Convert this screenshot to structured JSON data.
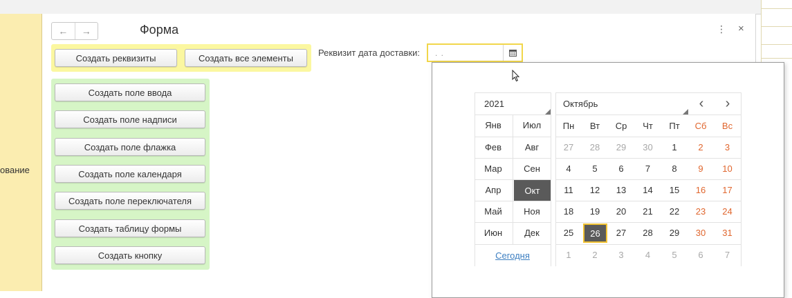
{
  "background_label": "ование",
  "form": {
    "title": "Форма",
    "back_icon": "←",
    "forward_icon": "→",
    "more_icon": "⋮",
    "close_icon": "×"
  },
  "yellow_group": {
    "buttons": [
      "Создать реквизиты",
      "Создать все элементы"
    ]
  },
  "green_group": {
    "buttons": [
      "Создать поле ввода",
      "Создать поле надписи",
      "Создать поле флажка",
      "Создать поле календаря",
      "Создать поле переключателя",
      "Создать таблицу формы",
      "Создать кнопку"
    ]
  },
  "date_field": {
    "label": "Реквизит дата доставки:",
    "value": " .  . ",
    "calendar_icon": "calendar-icon"
  },
  "calendar": {
    "year": "2021",
    "month": "Октябрь",
    "prev": "‹",
    "next": "›",
    "months_col1": [
      "Янв",
      "Фев",
      "Мар",
      "Апр",
      "Май",
      "Июн"
    ],
    "months_col2": [
      "Июл",
      "Авг",
      "Сен",
      "Окт",
      "Ноя",
      "Дек"
    ],
    "selected_month": "Окт",
    "weekdays": [
      "Пн",
      "Вт",
      "Ср",
      "Чт",
      "Пт",
      "Сб",
      "Вс"
    ],
    "weeks": [
      [
        "27",
        "28",
        "29",
        "30",
        "1",
        "2",
        "3"
      ],
      [
        "4",
        "5",
        "6",
        "7",
        "8",
        "9",
        "10"
      ],
      [
        "11",
        "12",
        "13",
        "14",
        "15",
        "16",
        "17"
      ],
      [
        "18",
        "19",
        "20",
        "21",
        "22",
        "23",
        "24"
      ],
      [
        "25",
        "26",
        "27",
        "28",
        "29",
        "30",
        "31"
      ],
      [
        "1",
        "2",
        "3",
        "4",
        "5",
        "6",
        "7"
      ]
    ],
    "muted_weeks": {
      "0": [
        0,
        1,
        2,
        3
      ],
      "5": [
        0,
        1,
        2,
        3,
        4,
        5,
        6
      ]
    },
    "selected_day": "26",
    "today_label": "Сегодня"
  },
  "colors": {
    "yellow_group": "#fbf7a0",
    "green_group": "#d6f5c6",
    "side_panel": "#fbedb0",
    "weekend": "#e0662e",
    "selected": "#5a5a5a",
    "highlight_border": "#f1c232",
    "link": "#3d7fc1"
  }
}
